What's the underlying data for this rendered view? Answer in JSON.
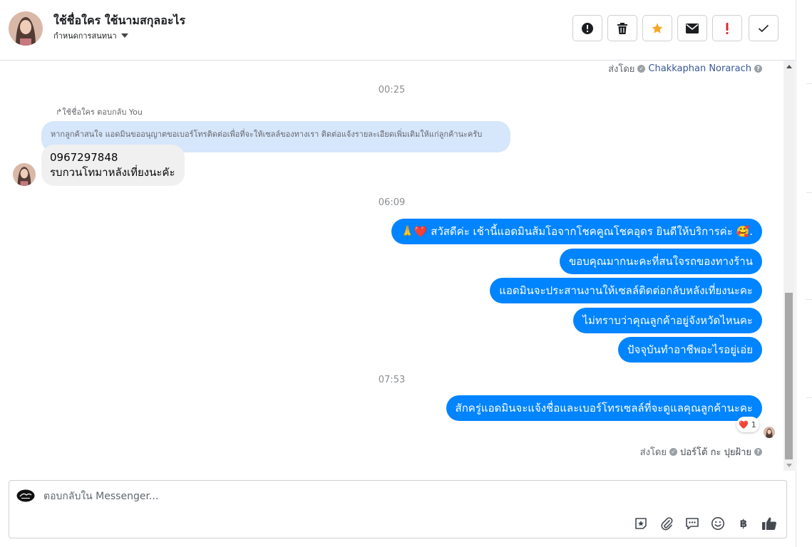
{
  "header": {
    "name": "ใช้ชื่อใคร ใช้นามสกุลอะไร",
    "subtitle": "กำหนดการสนทนา",
    "action_icons": [
      "alert-circle-icon",
      "trash-icon",
      "star-icon",
      "envelope-icon",
      "exclamation-icon",
      "checkmark-icon"
    ],
    "star_color": "#f5a623"
  },
  "conversation": {
    "sent_by_top": {
      "label": "ส่งโดย",
      "name": "Chakkaphan Norarach"
    },
    "time_1": "00:25",
    "reply_note": "↱ใช้ชื่อใคร ตอบกลับ You",
    "quoted_text": "หากลูกค้าสนใจ แอดมินขออนุญาตขอเบอร์โทรติดต่อเพื่อที่จะให้เซลล์ของทางเรา ติดต่อแจ้งรายละเอียดเพิ่มเติมให้แก่ลูกค้านะครับ",
    "incoming": {
      "line1": "0967297848",
      "line2": "รบกวนโทมาหลังเที่ยงนะคัะ"
    },
    "time_2": "06:09",
    "outgoing_1": [
      "🙏❤️ สวัสดีค่ะ เช้านี้แอดมินส้มโอจากโชคคูณโชคอุดร ยินดีให้บริการค่ะ 🥰.",
      "ขอบคุณมากนะคะที่สนใจรถของทางร้าน",
      "แอดมินจะประสานงานให้เซลล์ติดต่อกลับหลังเที่ยงนะคะ",
      "ไม่ทราบว่าคุณลูกค้าอยู่จังหวัดไหนคะ",
      "ปัจจุบันทำอาชีพอะไรอยู่เอ่ย"
    ],
    "time_3": "07:53",
    "outgoing_2": "สักครู่แอดมินจะแจ้งชื่อและเบอร์โทรเซลล์ที่จะดูแลคุณลูกค้านะคะ",
    "reaction": {
      "emoji": "❤️",
      "count": "1"
    },
    "sent_by_bottom": {
      "label": "ส่งโดย",
      "name": "ปอร์โต้ กะ ปุยฝ้าย"
    },
    "bubble_color": "#0084ff"
  },
  "composer": {
    "placeholder": "ตอบกลับใน Messenger...",
    "tool_icons": [
      "sticker-icon",
      "paperclip-icon",
      "saved-replies-icon",
      "emoji-icon",
      "baht-icon",
      "thumbs-up-icon"
    ],
    "baht_symbol": "฿"
  }
}
